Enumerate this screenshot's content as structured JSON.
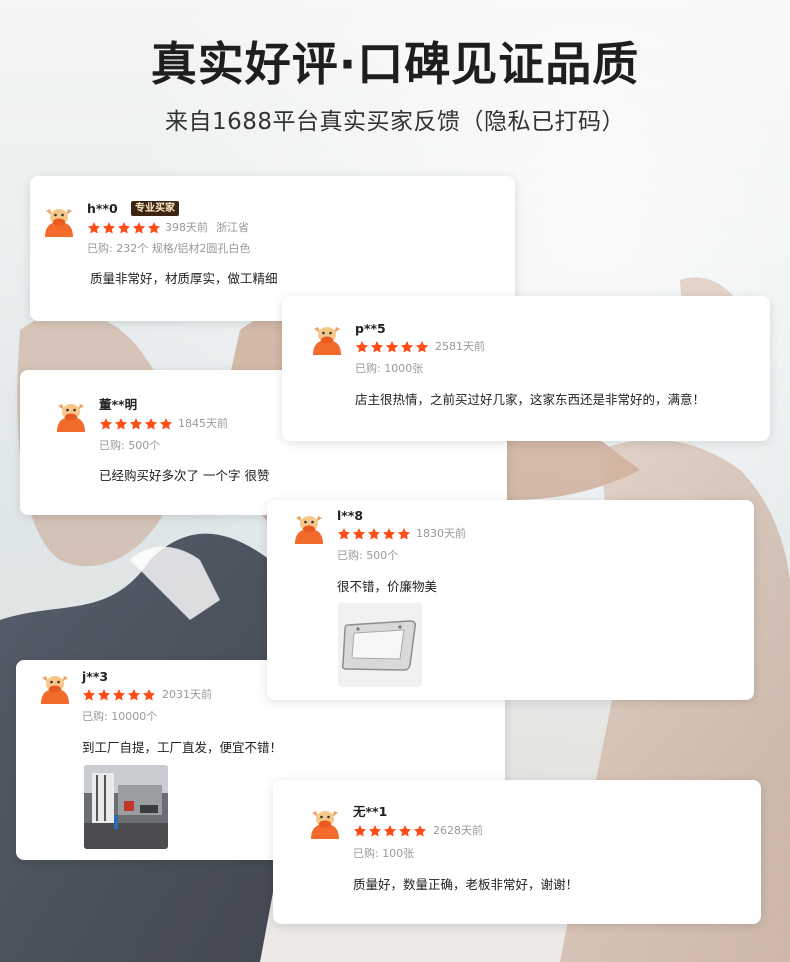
{
  "header": {
    "title": "真实好评·口碑见证品质",
    "subtitle": "来自1688平台真实买家反馈（隐私已打码）"
  },
  "theme": {
    "star_color": "#ff4d1a",
    "avatar_color": "#f26b2a",
    "badge_bg": "#3b2515"
  },
  "reviews": [
    {
      "name": "h**0",
      "badge": "专业买家",
      "rating": 5,
      "days_ago": "398天前",
      "region": "浙江省",
      "purchase": "已购: 232个 规格/铝材2圆孔白色",
      "comment": "质量非常好，材质厚实，做工精细",
      "avatar_icon": "bull-mascot-icon"
    },
    {
      "name": "p**5",
      "rating": 5,
      "days_ago": "2581天前",
      "purchase": "已购: 1000张",
      "comment": "店主很热情，之前买过好几家，这家东西还是非常好的，满意！",
      "avatar_icon": "bull-mascot-icon"
    },
    {
      "name": "董**明",
      "rating": 5,
      "days_ago": "1845天前",
      "purchase": "已购: 500个",
      "comment": "已经购买好多次了 一个字 很赞",
      "avatar_icon": "bull-mascot-icon"
    },
    {
      "name": "l**8",
      "rating": 5,
      "days_ago": "1830天前",
      "purchase": "已购: 500个",
      "comment": "很不错，价廉物美",
      "avatar_icon": "bull-mascot-icon",
      "photo": "license-plate-frame-photo"
    },
    {
      "name": "j**3",
      "rating": 5,
      "days_ago": "2031天前",
      "purchase": "已购: 10000个",
      "comment": "到工厂自提，工厂直发，便宜不错！",
      "avatar_icon": "bull-mascot-icon",
      "photo": "factory-interior-photo"
    },
    {
      "name": "无**1",
      "rating": 5,
      "days_ago": "2628天前",
      "purchase": "已购: 100张",
      "comment": "质量好，数量正确，老板非常好，谢谢！",
      "avatar_icon": "bull-mascot-icon"
    }
  ]
}
